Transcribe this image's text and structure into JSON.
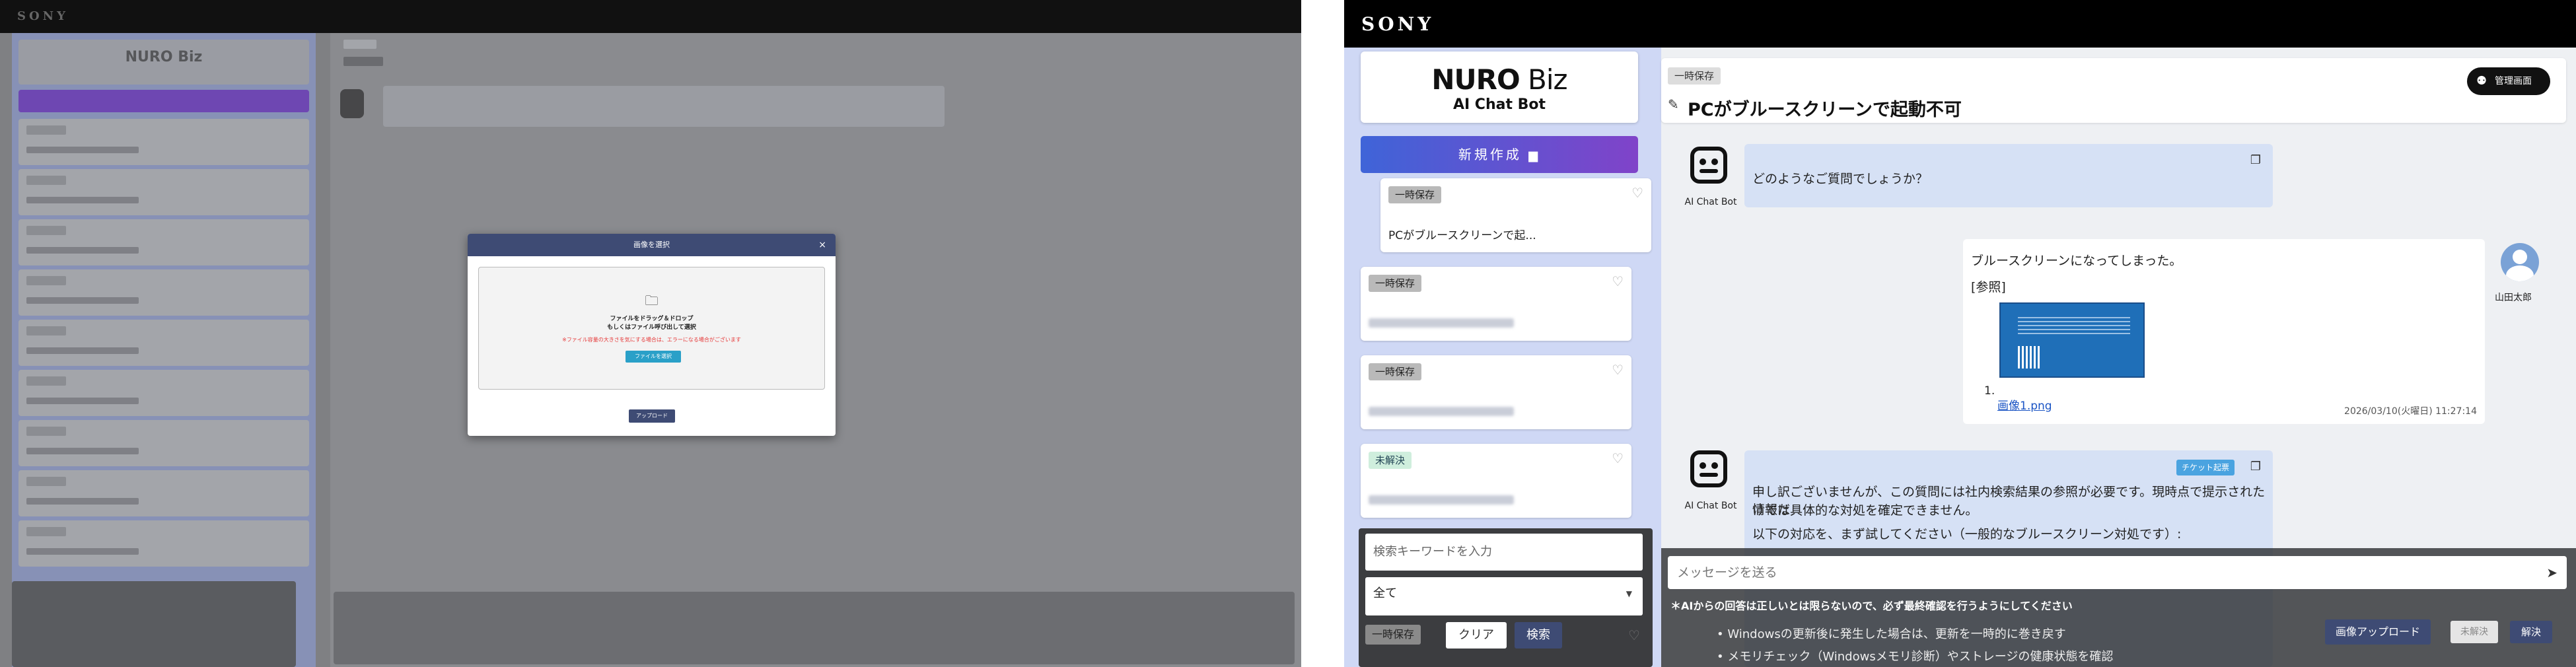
{
  "brand": "SONY",
  "sidebar": {
    "logo_main": "NURO",
    "logo_biz": " Biz",
    "logo_sub": "AI Chat Bot",
    "new_button": "新規作成",
    "cards": [
      {
        "chip": "一時保存",
        "text": "PCがブルースクリーンで起..."
      },
      {
        "chip": "一時保存",
        "text": ""
      },
      {
        "chip": "一時保存",
        "text": ""
      },
      {
        "chip": "未解決",
        "text": ""
      }
    ],
    "search_placeholder": "検索キーワードを入力",
    "filter_value": "全て",
    "bottom_chip": "一時保存",
    "clear_label": "クリア",
    "search_label": "検索"
  },
  "header": {
    "chip": "一時保存",
    "title": "PCがブルースクリーンで起動不可",
    "admin_label": "管理画面"
  },
  "conversation": {
    "bot_name": "AI Chat Bot",
    "bot_greeting": "どのようなご質問でしょうか？",
    "user_text": "ブルースクリーンになってしまった。",
    "ref_label": "[参照]",
    "image_index": "1.",
    "image_link": "画像1.png",
    "timestamp": "2026/03/10(火曜日) 11:27:14",
    "user_name": "山田太郎",
    "ticket_label": "チケット起票",
    "bot_reply_line1": "申し訳ございませんが、この質問には社内検索結果の参照が必要です。現時点で提示された情報だ",
    "bot_reply_line2": "けでは具体的な対処を確定できません。",
    "bot_reply_line3": "以下の対応を、まず試してください（一般的なブルースクリーン対処です）:",
    "bullet1": "Windowsの更新後に発生した場合は、更新を一時的に巻き戻す",
    "bullet2": "メモリチェック（Windowsメモリ診断）やストレージの健康状態を確認"
  },
  "composer": {
    "placeholder": "メッセージを送る",
    "disclaimer": "＊AIからの回答は正しいとは限らないので、必ず最終確認を行うようにしてください",
    "image_upload": "画像アップロード",
    "unsolved": "未解決",
    "solved": "解決"
  },
  "modal": {
    "title": "画像を選択",
    "close": "×",
    "drop_line1": "ファイルをドラッグ＆ドロップ",
    "drop_line2": "もしくはファイル呼び出して選択",
    "warning": "※ファイル容量の大きさを気にする場合は、エラーになる場合がございます",
    "choose_button": "ファイルを選択",
    "upload_button": "アップロード"
  },
  "left_blurred": {
    "logo": "NURO Biz",
    "logo_sub": "AI Chat Bot"
  },
  "colors": {
    "accent": "#3e4b74",
    "new_button_gradient": [
      "#3f64d8",
      "#8043c9"
    ],
    "ticket": "#4aa3e0",
    "link": "#1a54c4"
  }
}
